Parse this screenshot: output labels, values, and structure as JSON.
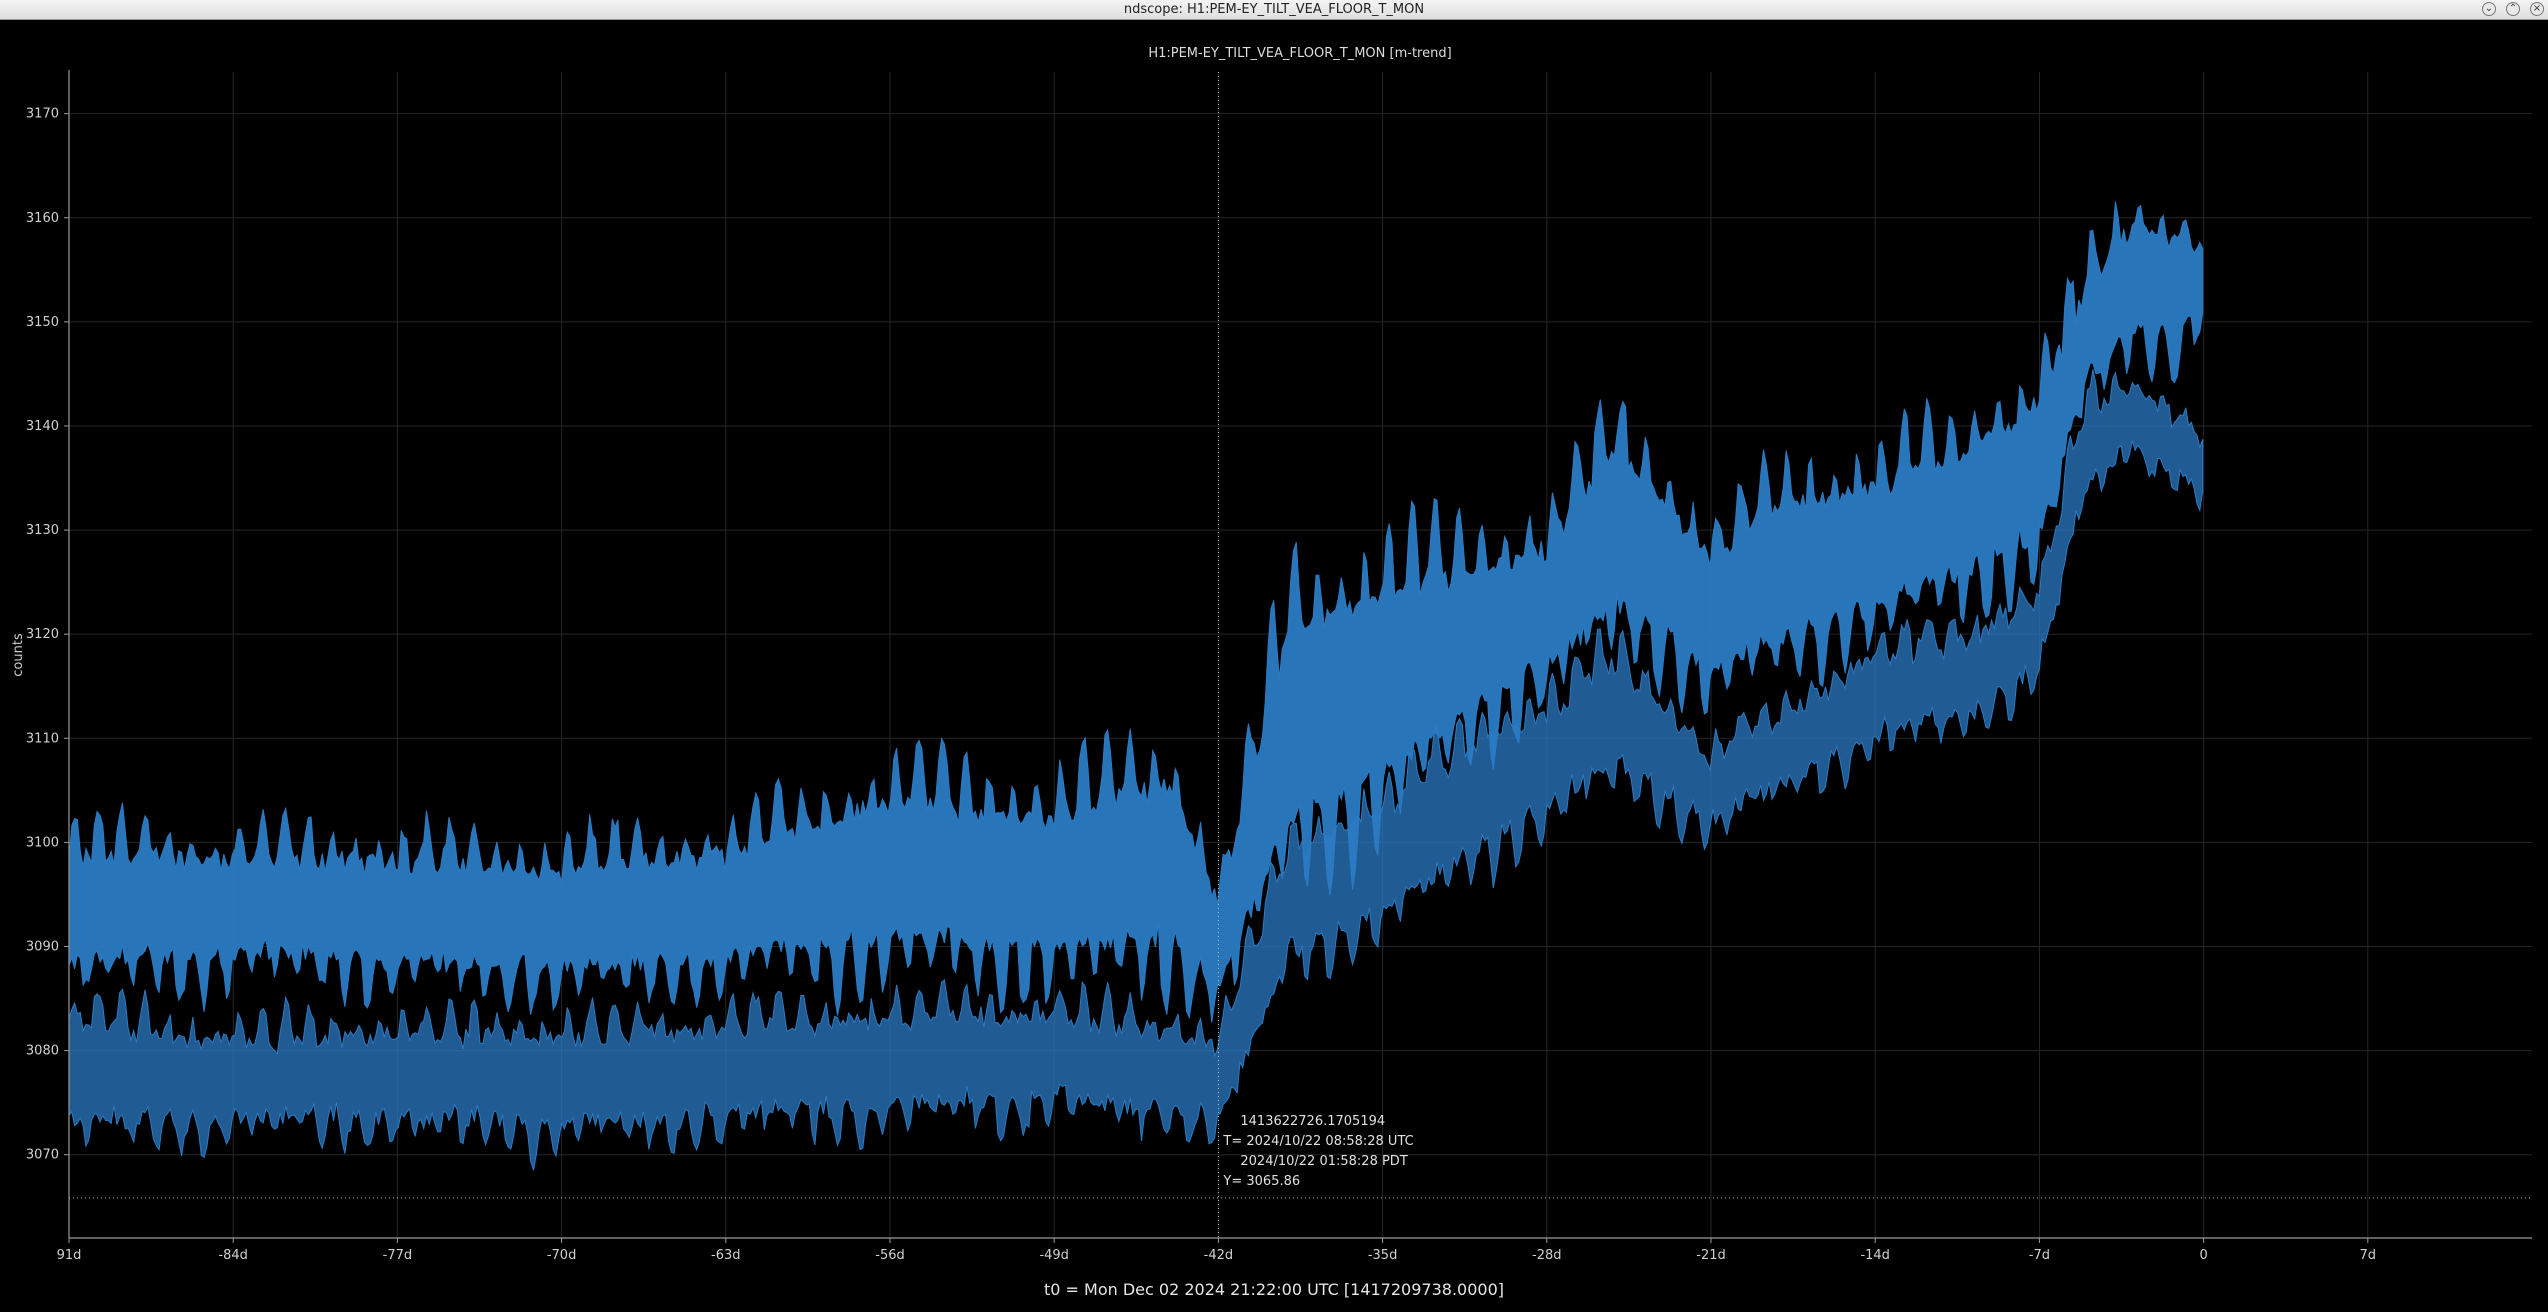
{
  "window": {
    "title": "ndscope: H1:PEM-EY_TILT_VEA_FLOOR_T_MON",
    "buttons": [
      "minimize-icon",
      "maximize-icon",
      "close-icon"
    ]
  },
  "footer": {
    "t0_text": "t0 = Mon Dec 02 2024 21:22:00 UTC [1417209738.0000]"
  },
  "cursor": {
    "gps_text": "1413622726.1705194",
    "utc_text": "T= 2024/10/22 08:58:28 UTC",
    "pdt_text": "2024/10/22 01:58:28 PDT",
    "y_text": "Y= 3065.86",
    "x_days": -42,
    "y_value": 3065.86
  },
  "chart_data": {
    "type": "line",
    "title": "H1:PEM-EY_TILT_VEA_FLOOR_T_MON [m-trend]",
    "ylabel": "counts",
    "xlabel": "",
    "xlim": [
      -91,
      14
    ],
    "ylim": [
      3062,
      3174
    ],
    "x_ticks": [
      -91,
      -84,
      -77,
      -70,
      -63,
      -56,
      -49,
      -42,
      -35,
      -28,
      -21,
      -14,
      -7,
      0,
      7
    ],
    "x_tick_labels": [
      "91d",
      "-84d",
      "-77d",
      "-70d",
      "-63d",
      "-56d",
      "-49d",
      "-42d",
      "-35d",
      "-28d",
      "-21d",
      "-14d",
      "-7d",
      "0",
      "7d"
    ],
    "y_ticks": [
      3070,
      3080,
      3090,
      3100,
      3110,
      3120,
      3130,
      3140,
      3150,
      3160,
      3170
    ],
    "grid": true,
    "color": "#2b7bc4",
    "series": [
      {
        "x": [
          -91,
          -84,
          -77,
          -70,
          -63,
          -56,
          -49,
          -44,
          -42,
          -39,
          -35,
          -30,
          -28,
          -25,
          -21,
          -18,
          -14,
          -10,
          -7,
          -5,
          -3,
          -1,
          0
        ],
        "max": [
          3103,
          3102,
          3102,
          3101,
          3103,
          3110,
          3108,
          3113,
          3097,
          3130,
          3132,
          3133,
          3133,
          3145,
          3132,
          3138,
          3139,
          3143,
          3148,
          3157,
          3163,
          3162,
          3159
        ],
        "min": [
          3084,
          3086,
          3085,
          3084,
          3085,
          3085,
          3084,
          3084,
          3083,
          3093,
          3098,
          3109,
          3112,
          3116,
          3112,
          3114,
          3118,
          3121,
          3124,
          3141,
          3146,
          3144,
          3150
        ]
      },
      {
        "x": [
          -91,
          -84,
          -77,
          -70,
          -63,
          -56,
          -49,
          -44,
          -42,
          -39,
          -35,
          -30,
          -28,
          -25,
          -21,
          -18,
          -14,
          -10,
          -7,
          -5,
          -3,
          -1,
          0
        ],
        "max": [
          3086,
          3083,
          3084,
          3084,
          3085,
          3086,
          3086,
          3084,
          3083,
          3102,
          3107,
          3115,
          3116,
          3121,
          3110,
          3114,
          3120,
          3122,
          3126,
          3144,
          3145,
          3142,
          3140
        ],
        "min": [
          3070,
          3071,
          3071,
          3070,
          3071,
          3072,
          3073,
          3072,
          3071,
          3086,
          3090,
          3097,
          3100,
          3104,
          3100,
          3104,
          3108,
          3110,
          3115,
          3132,
          3137,
          3134,
          3133
        ]
      }
    ]
  }
}
